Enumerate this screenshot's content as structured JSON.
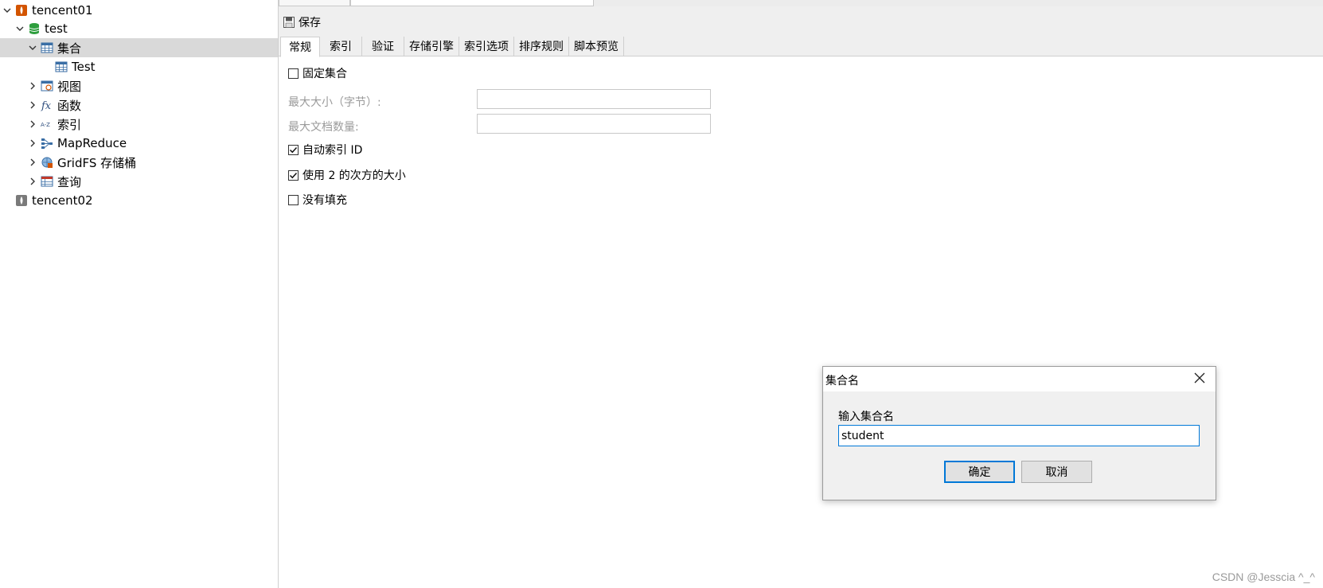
{
  "sidebar": {
    "items": [
      {
        "label": "tencent01",
        "icon": "mongodb-connection-icon"
      },
      {
        "label": "test",
        "icon": "database-icon"
      },
      {
        "label": "集合",
        "icon": "collection-table-icon"
      },
      {
        "label": "Test",
        "icon": "table-icon"
      },
      {
        "label": "视图",
        "icon": "view-icon"
      },
      {
        "label": "函数",
        "icon": "function-fx-icon"
      },
      {
        "label": "索引",
        "icon": "index-az-icon"
      },
      {
        "label": "MapReduce",
        "icon": "mapreduce-icon"
      },
      {
        "label": "GridFS 存储桶",
        "icon": "gridfs-bucket-icon"
      },
      {
        "label": "查询",
        "icon": "query-icon"
      },
      {
        "label": "tencent02",
        "icon": "mongodb-connection-icon"
      }
    ]
  },
  "toolbar": {
    "save_label": "保存"
  },
  "tabs": [
    "常规",
    "索引",
    "验证",
    "存储引擎",
    "索引选项",
    "排序规则",
    "脚本预览"
  ],
  "general": {
    "capped_label": "固定集合",
    "max_size_label": "最大大小（字节）:",
    "max_docs_label": "最大文档数量:",
    "max_size_value": "",
    "max_docs_value": "",
    "auto_index_label": "自动索引 ID",
    "power_of_2_label": "使用 2 的次方的大小",
    "no_padding_label": "没有填充",
    "capped_checked": false,
    "auto_index_checked": true,
    "power_of_2_checked": true,
    "no_padding_checked": false
  },
  "dialog": {
    "title": "集合名",
    "prompt": "输入集合名",
    "input_value": "student",
    "ok_label": "确定",
    "cancel_label": "取消"
  },
  "watermark": "CSDN @Jesscia ^_^",
  "colors": {
    "selected_row": "#d9d9d9",
    "accent": "#0078d7",
    "mongodb_orange": "#d35400",
    "database_green": "#2e9e3e"
  }
}
